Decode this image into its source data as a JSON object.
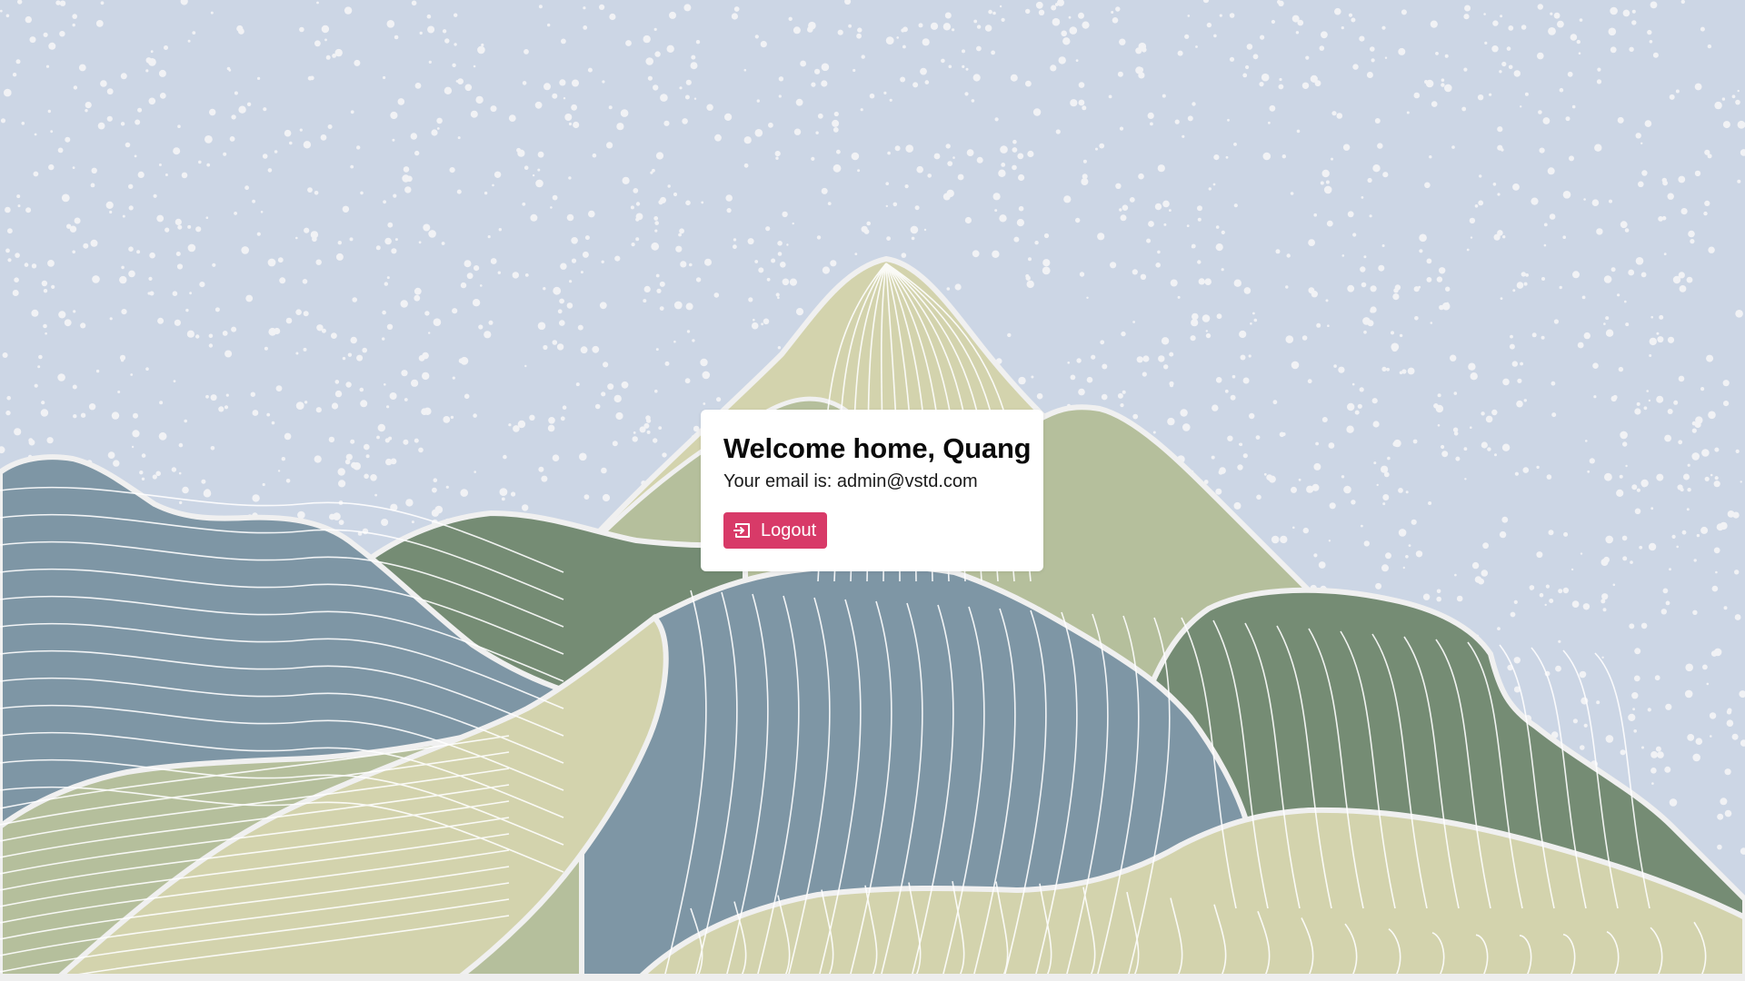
{
  "page": {
    "background_color": "#ccd6e5"
  },
  "welcome_card": {
    "title": "Welcome home, Quang",
    "email_line": "Your email is: admin@vstd.com"
  },
  "logout_button": {
    "label": "Logout",
    "icon": "logout-icon",
    "color": "#d83a68"
  },
  "illustration": {
    "subject": "snowy mountain landscape illustration",
    "colors": {
      "sky": "#ccd6e5",
      "snow": "#f1f2f5",
      "blue_hill": "#7e96a5",
      "dark_green_hill": "#758c74",
      "sage_hill": "#b5bf9c",
      "cream_hill": "#d3d3ad",
      "outline": "#f0f0f0"
    }
  }
}
